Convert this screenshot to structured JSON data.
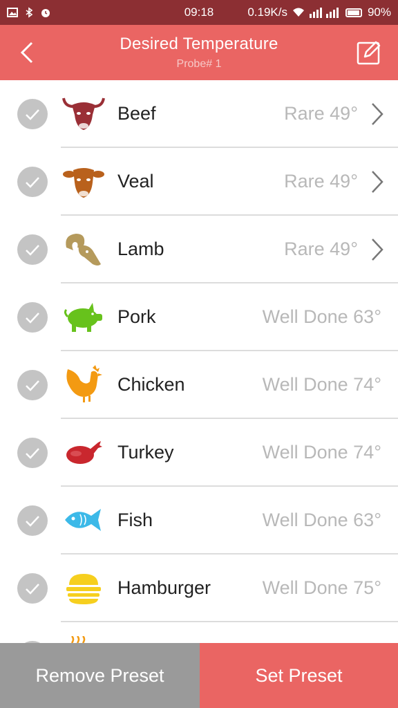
{
  "status_bar": {
    "time": "09:18",
    "network_speed": "0.19K/s",
    "battery": "90%"
  },
  "header": {
    "title": "Desired Temperature",
    "subtitle": "Probe# 1"
  },
  "items": [
    {
      "name": "Beef",
      "value": "Rare  49°",
      "icon": "beef-icon",
      "color": "#9a2f36",
      "chevron": true
    },
    {
      "name": "Veal",
      "value": "Rare  49°",
      "icon": "veal-icon",
      "color": "#b9611c",
      "chevron": true
    },
    {
      "name": "Lamb",
      "value": "Rare  49°",
      "icon": "lamb-icon",
      "color": "#b59a5c",
      "chevron": true
    },
    {
      "name": "Pork",
      "value": "Well Done  63°",
      "icon": "pork-icon",
      "color": "#67c21c",
      "chevron": false
    },
    {
      "name": "Chicken",
      "value": "Well Done  74°",
      "icon": "chicken-icon",
      "color": "#f39a12",
      "chevron": false
    },
    {
      "name": "Turkey",
      "value": "Well Done  74°",
      "icon": "turkey-icon",
      "color": "#c9272e",
      "chevron": false
    },
    {
      "name": "Fish",
      "value": "Well Done  63°",
      "icon": "fish-icon",
      "color": "#3cb9e8",
      "chevron": false
    },
    {
      "name": "Hamburger",
      "value": "Well Done  75°",
      "icon": "hamburger-icon",
      "color": "#f6cf1e",
      "chevron": false
    }
  ],
  "buttons": {
    "remove_label": "Remove Preset",
    "set_label": "Set Preset"
  },
  "colors": {
    "accent": "#ea6563",
    "status_bar": "#8c2f33",
    "disabled_button": "#9a9a9a"
  }
}
